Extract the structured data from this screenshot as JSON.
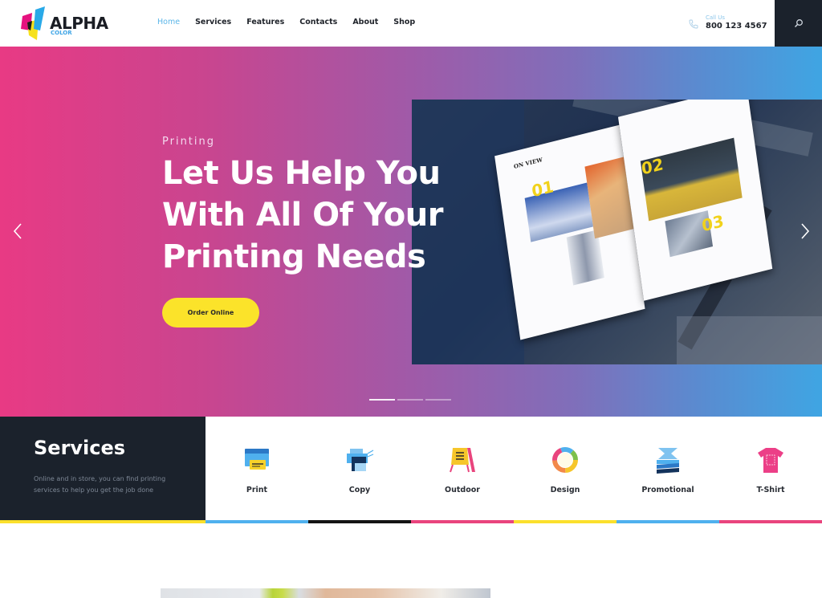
{
  "header": {
    "logo": {
      "name": "ALPHA",
      "sub": "COLOR"
    },
    "nav": [
      {
        "label": "Home",
        "active": true
      },
      {
        "label": "Services",
        "active": false
      },
      {
        "label": "Features",
        "active": false
      },
      {
        "label": "Contacts",
        "active": false
      },
      {
        "label": "About",
        "active": false
      },
      {
        "label": "Shop",
        "active": false
      }
    ],
    "call": {
      "label": "Call Us",
      "number": "800 123 4567",
      "icon": "phone-icon"
    },
    "search_icon": "search-icon"
  },
  "hero": {
    "subtitle": "Printing",
    "title": "Let Us Help You With All Of Your Printing Needs",
    "button_label": "Order Online",
    "prev_icon": "chevron-left-icon",
    "next_icon": "chevron-right-icon",
    "slides_total": 3,
    "slide_active": 1,
    "magazine": {
      "heading": "ON VIEW",
      "numbers": [
        "01",
        "02",
        "03"
      ]
    }
  },
  "services": {
    "title": "Services",
    "description": "Online and in store, you can find printing services to help you get the job done",
    "items": [
      {
        "label": "Print",
        "icon": "printer-icon",
        "stripe_color": "#4fb0ee"
      },
      {
        "label": "Copy",
        "icon": "copier-icon",
        "stripe_color": "#141414"
      },
      {
        "label": "Outdoor",
        "icon": "sign-board-icon",
        "stripe_color": "#e9447d"
      },
      {
        "label": "Design",
        "icon": "color-wheel-icon",
        "stripe_color": "#fbe02c"
      },
      {
        "label": "Promotional",
        "icon": "flyers-icon",
        "stripe_color": "#4fb0ee"
      },
      {
        "label": "T-Shirt",
        "icon": "tshirt-icon",
        "stripe_color": "#e9447d"
      }
    ],
    "left_stripe_color": "#fbe02c"
  },
  "colors": {
    "accent_blue": "#5bb6e8",
    "accent_yellow": "#fbe32a",
    "accent_pink": "#e83a84",
    "dark": "#1b222c"
  }
}
